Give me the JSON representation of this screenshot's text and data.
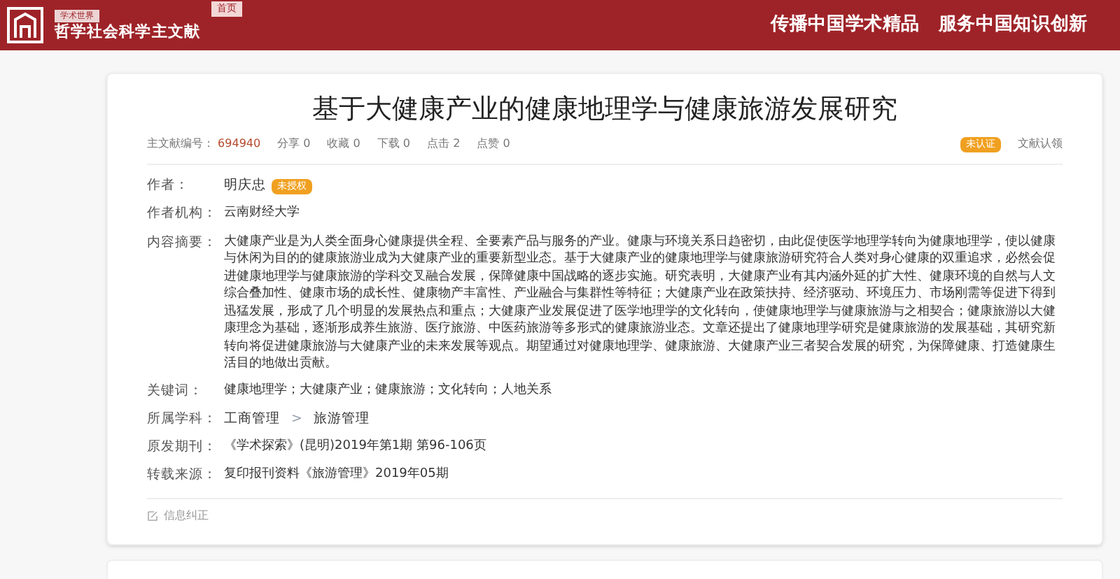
{
  "header": {
    "badge": "学术世界",
    "site_name": "哲学社会科学主文献",
    "home_tab": "首页",
    "slogan": "传播中国学术精品　服务中国知识创新"
  },
  "article": {
    "title": "基于大健康产业的健康地理学与健康旅游发展研究",
    "meta": [
      {
        "label": "主文献编号：",
        "value": "694940",
        "highlight": true
      },
      {
        "label": "分享",
        "value": "0",
        "highlight": false
      },
      {
        "label": "收藏",
        "value": "0",
        "highlight": false
      },
      {
        "label": "下载",
        "value": "0",
        "highlight": false
      },
      {
        "label": "点击",
        "value": "2",
        "highlight": false
      },
      {
        "label": "点赞",
        "value": "0",
        "highlight": false
      }
    ],
    "claim_badge": "未认证",
    "claim_link": "文献认领",
    "fields": [
      {
        "kind": "author",
        "label": "作者：",
        "value": "明庆忠",
        "badge": "未授权"
      },
      {
        "kind": "text",
        "label": "作者机构：",
        "value": "云南财经大学"
      },
      {
        "kind": "text",
        "label": "内容摘要：",
        "value": "大健康产业是为人类全面身心健康提供全程、全要素产品与服务的产业。健康与环境关系日趋密切，由此促使医学地理学转向为健康地理学，使以健康与休闲为目的的健康旅游业成为大健康产业的重要新型业态。基于大健康产业的健康地理学与健康旅游研究符合人类对身心健康的双重追求，必然会促进健康地理学与健康旅游的学科交叉融合发展，保障健康中国战略的逐步实施。研究表明，大健康产业有其内涵外延的扩大性、健康环境的自然与人文综合叠加性、健康市场的成长性、健康物产丰富性、产业融合与集群性等特征；大健康产业在政策扶持、经济驱动、环境压力、市场刚需等促进下得到迅猛发展，形成了几个明显的发展热点和重点；大健康产业发展促进了医学地理学的文化转向，使健康地理学与健康旅游与之相契合；健康旅游以大健康理念为基础，逐渐形成养生旅游、医疗旅游、中医药旅游等多形式的健康旅游业态。文章还提出了健康地理学研究是健康旅游的发展基础，其研究新转向将促进健康旅游与大健康产业的未来发展等观点。期望通过对健康地理学、健康旅游、大健康产业三者契合发展的研究，为保障健康、打造健康生活目的地做出贡献。"
      },
      {
        "kind": "text",
        "label": "关键词：",
        "value": "健康地理学；大健康产业；健康旅游；文化转向；人地关系"
      },
      {
        "kind": "path",
        "label": "所属学科：",
        "parts": [
          "工商管理",
          "旅游管理"
        ],
        "separator": ">"
      },
      {
        "kind": "text",
        "label": "原发期刊：",
        "value": "《学术探索》(昆明)2019年第1期 第96-106页"
      },
      {
        "kind": "text",
        "label": "转载来源：",
        "value": "复印报刊资料《旅游管理》2019年05期"
      }
    ],
    "correction_link": "信息纠正"
  }
}
